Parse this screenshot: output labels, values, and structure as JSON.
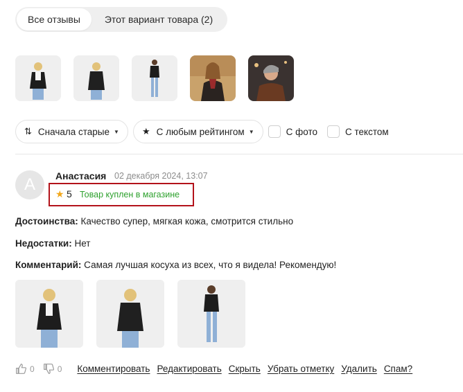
{
  "tabs": [
    {
      "label": "Все отзывы",
      "active": true
    },
    {
      "label": "Этот вариант товара (2)",
      "active": false
    }
  ],
  "gallery": [
    {
      "icon": "woman-leather-jacket-photo"
    },
    {
      "icon": "woman-back-view-photo"
    },
    {
      "icon": "woman-full-length-photo"
    },
    {
      "icon": "woman-street-photo"
    },
    {
      "icon": "woman-portrait-photo"
    }
  ],
  "filters": {
    "sort_label": "Сначала старые",
    "rating_label": "С любым рейтингом",
    "with_photo_label": "С фото",
    "with_text_label": "С текстом"
  },
  "review": {
    "avatar_letter": "А",
    "author": "Анастасия",
    "date": "02 декабря 2024, 13:07",
    "rating": "5",
    "purchase_badge": "Товар куплен в магазине",
    "pros_label": "Достоинства:",
    "pros": "Качество супер, мягкая кожа, смотрится стильно",
    "cons_label": "Недостатки:",
    "cons": "Нет",
    "comment_label": "Комментарий:",
    "comment": "Самая лучшая косуха из всех, что я видела! Рекомендую!",
    "likes": "0",
    "dislikes": "0"
  },
  "actions": {
    "comment": "Комментировать",
    "edit": "Редактировать",
    "hide": "Скрыть",
    "remove_mark": "Убрать отметку",
    "delete": "Удалить",
    "spam": "Спам?"
  },
  "colors": {
    "accent_green": "#2ea12e",
    "highlight_red": "#b3121a",
    "star": "#f2a71b"
  }
}
